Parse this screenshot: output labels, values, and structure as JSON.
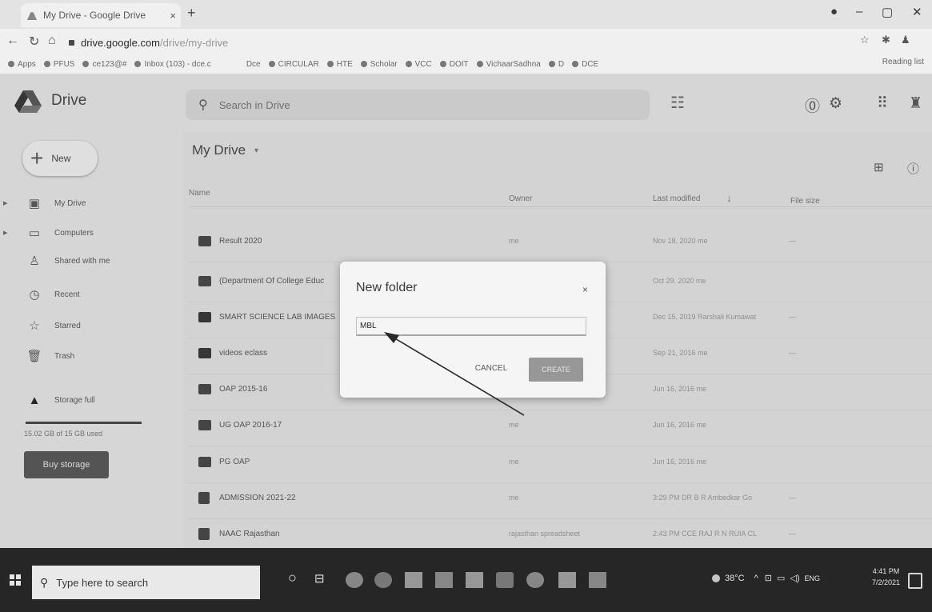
{
  "browser": {
    "tab_title": "My Drive - Google Drive",
    "new_tab": "+",
    "url_host": "drive.google.com",
    "url_path": "/drive/my-drive",
    "bookmarks": [
      "Apps",
      "PFUS",
      "ce123@#",
      "Inbox (103) - dce.c",
      "Dce",
      "CIRCULAR",
      "HTE",
      "Scholar",
      "VCC",
      "DOIT",
      "VichaarSadhna",
      "D",
      "DCE"
    ],
    "reading_list": "Reading list"
  },
  "drive": {
    "app_name": "Drive",
    "search_placeholder": "Search in Drive",
    "new_label": "New",
    "nav": [
      {
        "label": "My Drive",
        "icon": "drive-icon"
      },
      {
        "label": "Computers",
        "icon": "computer-icon"
      },
      {
        "label": "Shared with me",
        "icon": "people-icon"
      },
      {
        "label": "Recent",
        "icon": "clock-icon"
      },
      {
        "label": "Starred",
        "icon": "star-icon"
      },
      {
        "label": "Trash",
        "icon": "trash-icon"
      },
      {
        "label": "Storage full",
        "icon": "warning-icon"
      }
    ],
    "storage_text": "15.02 GB of 15 GB used",
    "storage_fraction": 1.0,
    "buy_storage": "Buy storage",
    "title": "My Drive",
    "columns": {
      "name": "Name",
      "owner": "Owner",
      "modified": "Last modified",
      "size": "File size"
    },
    "files": [
      {
        "name": "Result 2020",
        "owner": "me",
        "modified": "Nov 18, 2020 me",
        "size": "—",
        "icon": "folder-icon"
      },
      {
        "name": "(Department Of College Educ",
        "owner": "",
        "modified": "Oct 29, 2020 me",
        "size": "",
        "icon": "folder-icon"
      },
      {
        "name": "SMART SCIENCE LAB IMAGES",
        "owner": "",
        "modified": "Dec 15, 2019 Rarshali Kumawat",
        "size": "—",
        "icon": "shared-folder-icon"
      },
      {
        "name": "videos eclass",
        "owner": "",
        "modified": "Sep 21, 2016 me",
        "size": "—",
        "icon": "shared-folder-icon"
      },
      {
        "name": "OAP 2015-16",
        "owner": "",
        "modified": "Jun 16, 2016 me",
        "size": "",
        "icon": "folder-icon"
      },
      {
        "name": "UG OAP 2016-17",
        "owner": "me",
        "modified": "Jun 16, 2016 me",
        "size": "",
        "icon": "folder-icon"
      },
      {
        "name": "PG OAP",
        "owner": "me",
        "modified": "Jun 16, 2016 me",
        "size": "",
        "icon": "folder-icon"
      },
      {
        "name": "ADMISSION 2021-22",
        "owner": "me",
        "modified": "3:29 PM DR B R Ambedkar Go",
        "size": "—",
        "icon": "forms-icon"
      },
      {
        "name": "NAAC Rajasthan",
        "owner": "rajasthan spreadsheet",
        "modified": "2:43 PM CCE RAJ R N RUIA CL",
        "size": "—",
        "icon": "forms-icon"
      }
    ]
  },
  "dialog": {
    "title": "New folder",
    "close": "×",
    "input_value": "MBL",
    "cancel": "CANCEL",
    "create": "CREATE"
  },
  "taskbar": {
    "search_placeholder": "Type here to search",
    "temperature": "38°C",
    "language": "ENG",
    "time": "4:41 PM",
    "date": "7/2/2021"
  }
}
